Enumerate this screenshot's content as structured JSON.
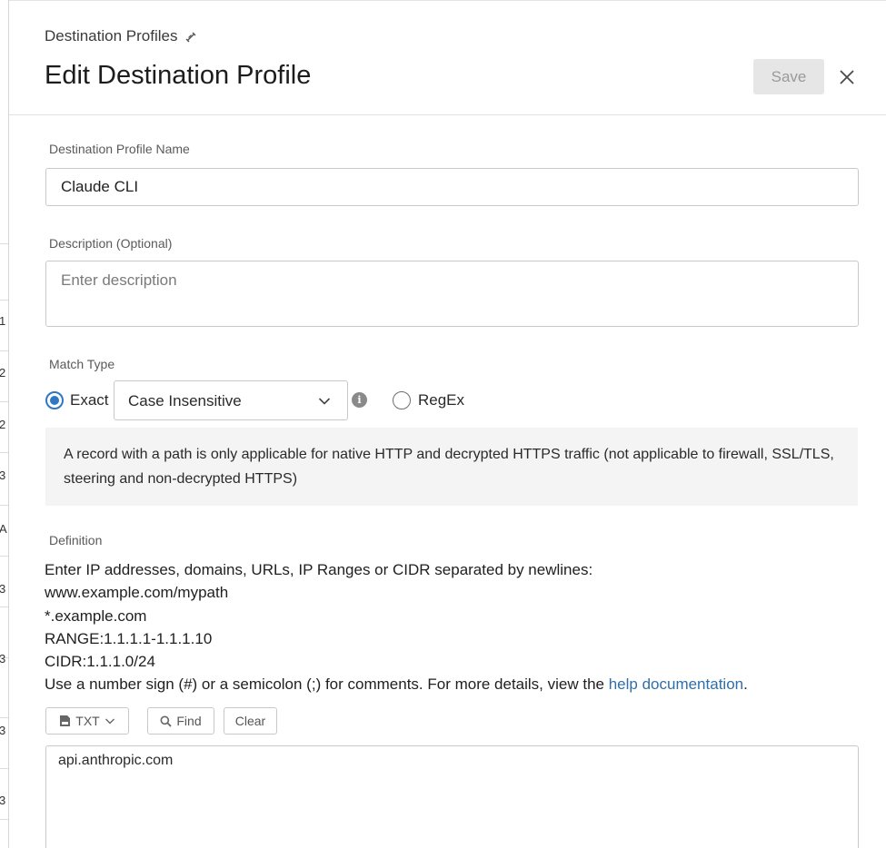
{
  "breadcrumb": {
    "label": "Destination Profiles"
  },
  "header": {
    "title": "Edit Destination Profile",
    "save_label": "Save"
  },
  "profile_name": {
    "label": "Destination Profile Name",
    "value": "Claude CLI"
  },
  "description": {
    "label": "Description (Optional)",
    "placeholder": "Enter description"
  },
  "match_type": {
    "label": "Match Type",
    "exact_label": "Exact",
    "exact_selected": true,
    "case_option": "Case Insensitive",
    "regex_label": "RegEx",
    "note": "A record with a path is only applicable for native HTTP and decrypted HTTPS traffic (not applicable to firewall, SSL/TLS, steering and non-decrypted HTTPS)"
  },
  "definition": {
    "label": "Definition",
    "lines": [
      "Enter IP addresses, domains, URLs, IP Ranges or CIDR separated by newlines:",
      "www.example.com/mypath",
      "*.example.com",
      "RANGE:1.1.1.1-1.1.1.10",
      "CIDR:1.1.1.0/24"
    ],
    "comment_prefix": "Use a number sign (#) or a semicolon (;) for comments. For more details, view the ",
    "help_link": "help documentation",
    "comment_suffix": ".",
    "toolbar": {
      "txt_label": "TXT",
      "find_label": "Find",
      "clear_label": "Clear"
    },
    "editor_value": "api.anthropic.com"
  },
  "background_glyphs": [
    "1",
    "2",
    "2",
    "3",
    "A",
    "3",
    "3",
    "3",
    "3"
  ],
  "colors": {
    "accent": "#2f78c4",
    "link": "#2f6fa8",
    "save_disabled_bg": "#e6e6e6"
  }
}
